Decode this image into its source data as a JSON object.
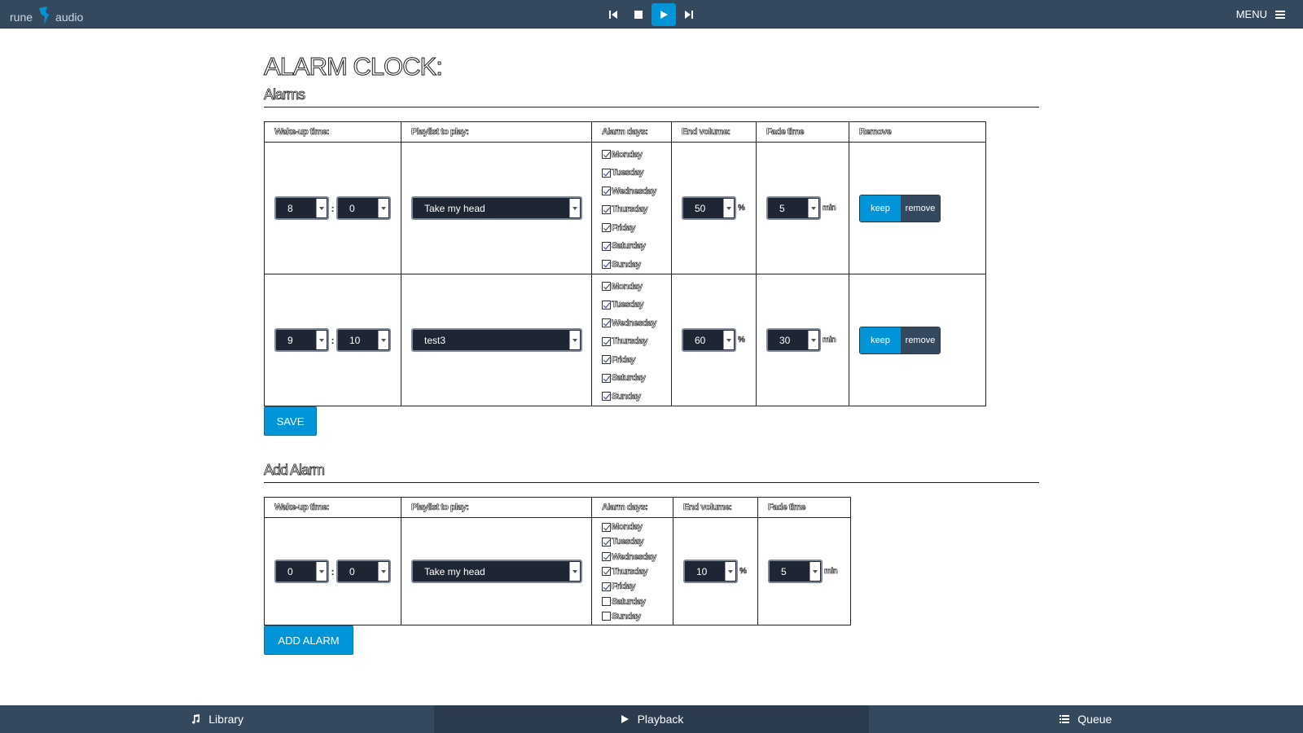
{
  "app": {
    "logo_left": "rune",
    "logo_right": "audio",
    "menu_label": "MENU"
  },
  "transport": {
    "icons": [
      "skip-previous-icon",
      "stop-icon",
      "play-icon",
      "skip-next-icon"
    ],
    "active": "play"
  },
  "page": {
    "title": "ALARM CLOCK:"
  },
  "alarms_section": {
    "title": "Alarms",
    "headers": [
      "Wake-up time:",
      "Playlist to play:",
      "Alarm days:",
      "End volume:",
      "Fade time",
      "Remove"
    ],
    "rows": [
      {
        "hour": "8",
        "minute": "0",
        "playlist": "Take my head",
        "days": [
          {
            "label": "Monday",
            "checked": true
          },
          {
            "label": "Tuesday",
            "checked": true
          },
          {
            "label": "Wednesday",
            "checked": true
          },
          {
            "label": "Thursday",
            "checked": true
          },
          {
            "label": "Friday",
            "checked": true
          },
          {
            "label": "Saturday",
            "checked": true
          },
          {
            "label": "Sunday",
            "checked": true
          }
        ],
        "volume": "50",
        "volume_unit": "%",
        "fade": "5",
        "fade_unit": "min",
        "keep_label": "keep",
        "remove_label": "remove"
      },
      {
        "hour": "9",
        "minute": "10",
        "playlist": "test3",
        "days": [
          {
            "label": "Monday",
            "checked": true
          },
          {
            "label": "Tuesday",
            "checked": true
          },
          {
            "label": "Wednesday",
            "checked": true
          },
          {
            "label": "Thursday",
            "checked": true
          },
          {
            "label": "Friday",
            "checked": true
          },
          {
            "label": "Saturday",
            "checked": true
          },
          {
            "label": "Sunday",
            "checked": true
          }
        ],
        "volume": "60",
        "volume_unit": "%",
        "fade": "30",
        "fade_unit": "min",
        "keep_label": "keep",
        "remove_label": "remove"
      }
    ],
    "save_label": "SAVE"
  },
  "add_section": {
    "title": "Add Alarm",
    "headers": [
      "Wake-up time:",
      "Playlist to play:",
      "Alarm days:",
      "End volume:",
      "Fade time"
    ],
    "row": {
      "hour": "0",
      "minute": "0",
      "playlist": "Take my head",
      "days": [
        {
          "label": "Monday",
          "checked": true
        },
        {
          "label": "Tuesday",
          "checked": true
        },
        {
          "label": "Wednesday",
          "checked": true
        },
        {
          "label": "Thursday",
          "checked": true
        },
        {
          "label": "Friday",
          "checked": true
        },
        {
          "label": "Saturday",
          "checked": false
        },
        {
          "label": "Sunday",
          "checked": false
        }
      ],
      "volume": "10",
      "volume_unit": "%",
      "fade": "5",
      "fade_unit": "min"
    },
    "add_label": "ADD ALARM"
  },
  "bottom_nav": [
    {
      "label": "Library",
      "icon": "music-note-icon"
    },
    {
      "label": "Playback",
      "icon": "play-icon",
      "active": true
    },
    {
      "label": "Queue",
      "icon": "list-icon"
    }
  ],
  "colors": {
    "accent": "#0095d8",
    "bar": "#34495e",
    "select_bg": "#1e2533"
  }
}
